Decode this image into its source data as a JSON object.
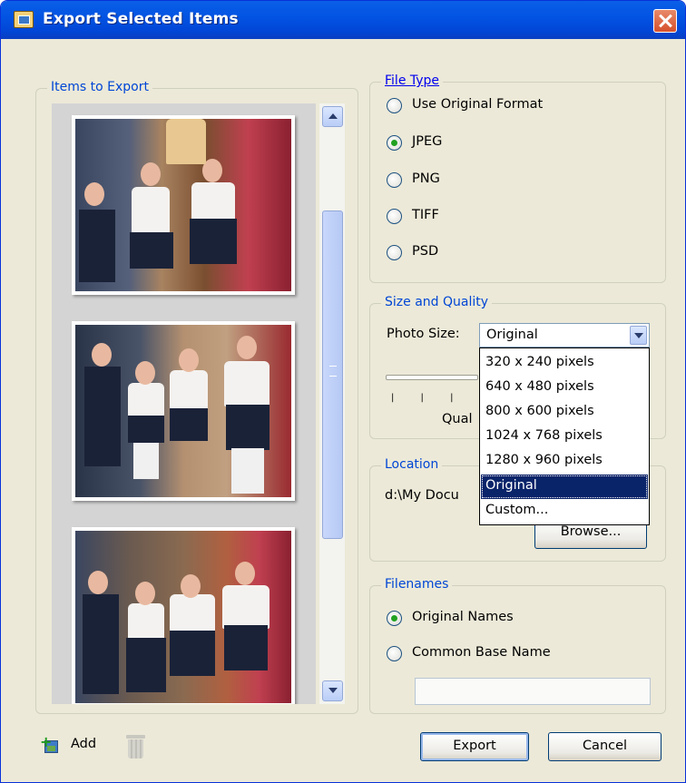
{
  "window": {
    "title": "Export Selected Items"
  },
  "items_to_export": {
    "legend": "Items to Export",
    "photos": [
      "photo-1",
      "photo-2",
      "photo-3"
    ]
  },
  "file_type": {
    "legend": "File Type",
    "options": [
      {
        "label": "Use Original Format",
        "checked": false
      },
      {
        "label": "JPEG",
        "checked": true
      },
      {
        "label": "PNG",
        "checked": false
      },
      {
        "label": "TIFF",
        "checked": false
      },
      {
        "label": "PSD",
        "checked": false
      }
    ]
  },
  "size_quality": {
    "legend": "Size and Quality",
    "photo_size_label": "Photo Size:",
    "photo_size_value": "Original",
    "options": [
      "320 x 240 pixels",
      "640 x 480 pixels",
      "800 x 600 pixels",
      "1024 x 768 pixels",
      "1280 x 960 pixels",
      "Original",
      "Custom..."
    ],
    "selected_option": "Original",
    "quality_label": "Qual",
    "ticks": "| | | | |"
  },
  "location": {
    "legend": "Location",
    "path": "d:\\My Docu",
    "browse_label": "Browse..."
  },
  "filenames": {
    "legend": "Filenames",
    "options": [
      {
        "label": "Original Names",
        "checked": true
      },
      {
        "label": "Common Base Name",
        "checked": false
      }
    ],
    "base_name_value": ""
  },
  "footer": {
    "add_label": "Add",
    "export_label": "Export",
    "cancel_label": "Cancel"
  },
  "colors": {
    "title_bar": "#0354e3",
    "selected_option_bg": "#0a246a",
    "radio_dot": "#21a121"
  }
}
